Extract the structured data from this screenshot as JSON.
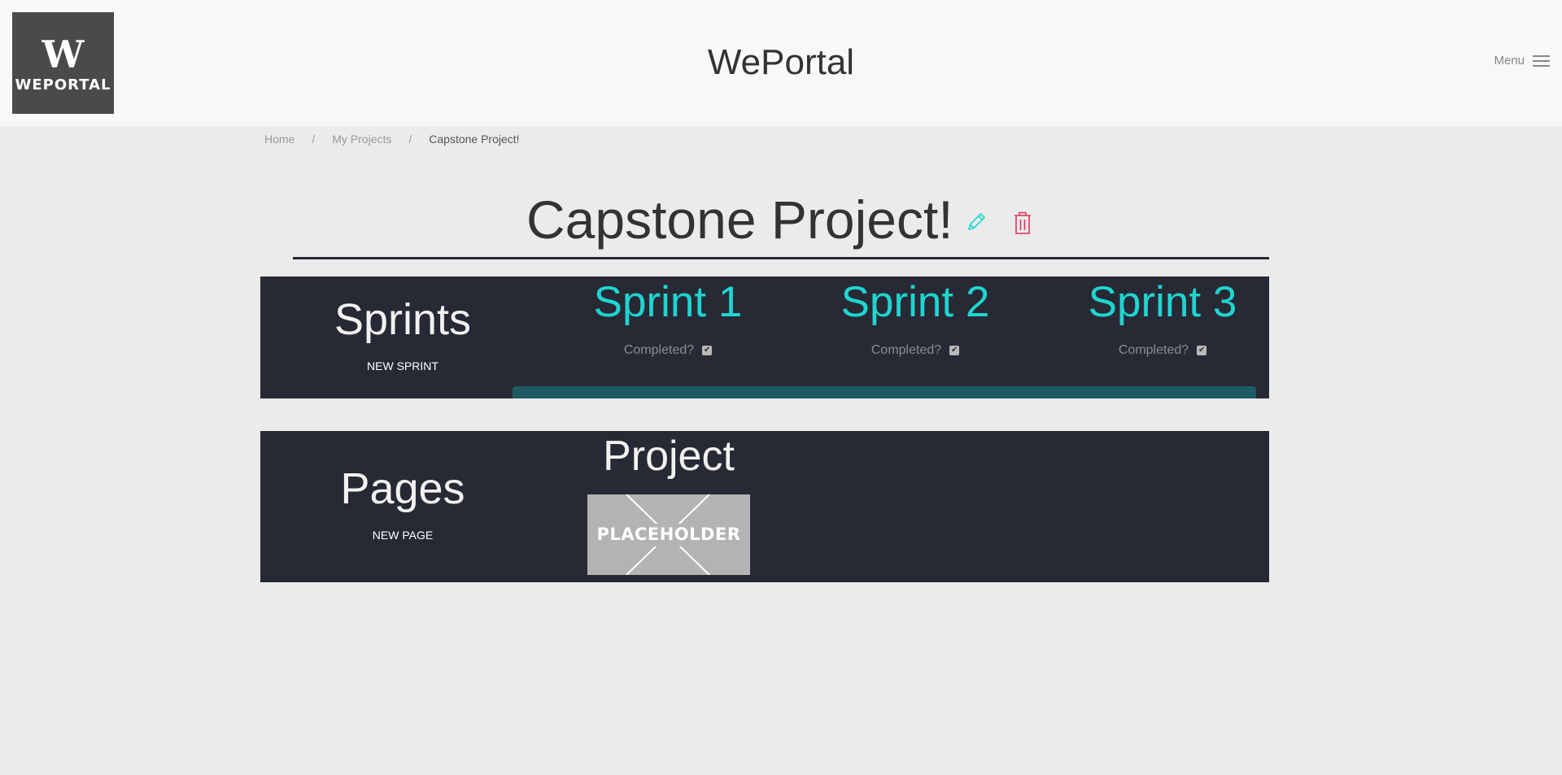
{
  "header": {
    "logo_mark": "W",
    "logo_text": "WEPORTAL",
    "title": "WePortal",
    "menu_label": "Menu"
  },
  "breadcrumb": {
    "items": [
      "Home",
      "My Projects",
      "Capstone Project!"
    ],
    "separator": "/"
  },
  "project": {
    "title": "Capstone Project!",
    "edit_icon": "pencil-icon",
    "delete_icon": "trash-icon",
    "edit_color": "#1fd5d1",
    "delete_color": "#e0325f"
  },
  "sprints": {
    "heading": "Sprints",
    "new_label": "NEW SPRINT",
    "items": [
      {
        "name": "Sprint 1",
        "status_label": "Completed?",
        "completed": true
      },
      {
        "name": "Sprint 2",
        "status_label": "Completed?",
        "completed": true
      },
      {
        "name": "Sprint 3",
        "status_label": "Completed?",
        "completed": true
      }
    ]
  },
  "pages": {
    "heading": "Pages",
    "new_label": "NEW PAGE",
    "items": [
      {
        "title": "Project",
        "thumbnail_text": "PLACEHOLDER"
      }
    ]
  },
  "colors": {
    "accent": "#1fd5d1",
    "panel": "#272a35",
    "danger": "#e0325f"
  }
}
